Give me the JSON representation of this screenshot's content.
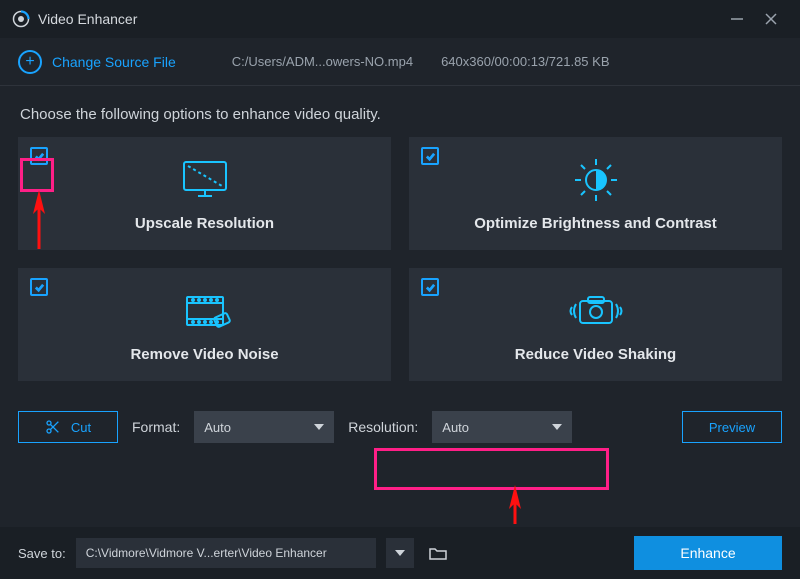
{
  "titlebar": {
    "title": "Video Enhancer"
  },
  "toolbar": {
    "change_source_label": "Change Source File",
    "file_path": "C:/Users/ADM...owers-NO.mp4",
    "file_meta": "640x360/00:00:13/721.85 KB"
  },
  "instruction": "Choose the following options to enhance video quality.",
  "cards": {
    "upscale": {
      "label": "Upscale Resolution",
      "checked": true
    },
    "brightness": {
      "label": "Optimize Brightness and Contrast",
      "checked": true
    },
    "denoise": {
      "label": "Remove Video Noise",
      "checked": true
    },
    "deshake": {
      "label": "Reduce Video Shaking",
      "checked": true
    }
  },
  "controls": {
    "cut_label": "Cut",
    "format_label": "Format:",
    "format_value": "Auto",
    "resolution_label": "Resolution:",
    "resolution_value": "Auto",
    "preview_label": "Preview"
  },
  "bottom": {
    "saveto_label": "Save to:",
    "path_value": "C:\\Vidmore\\Vidmore V...erter\\Video Enhancer",
    "enhance_label": "Enhance"
  }
}
